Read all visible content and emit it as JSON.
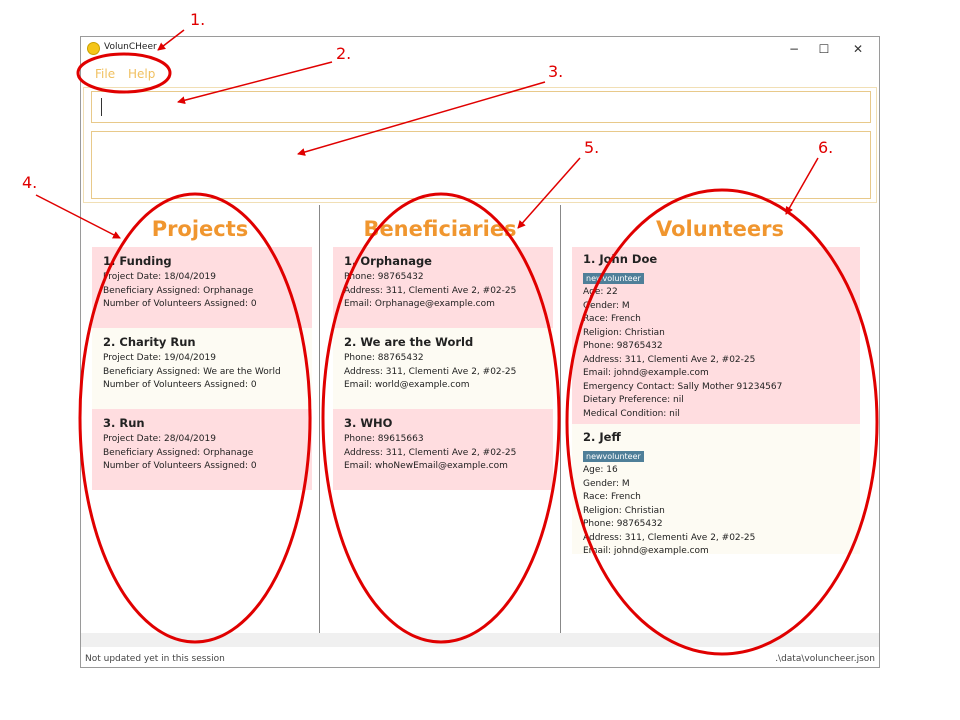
{
  "window": {
    "title": "VolunCHeer",
    "controls": {
      "minimize": "−",
      "maximize": "☐",
      "close": "✕"
    }
  },
  "menu": {
    "items": [
      "File",
      "Help"
    ]
  },
  "command_box": {
    "value": ""
  },
  "result_box": {
    "value": ""
  },
  "columns": {
    "projects": {
      "title": "Projects",
      "cards": [
        {
          "title": "1.  Funding",
          "lines": [
            "Project Date: 18/04/2019",
            "Beneficiary Assigned: Orphanage",
            "Number of Volunteers Assigned: 0"
          ]
        },
        {
          "title": "2.  Charity Run",
          "lines": [
            "Project Date: 19/04/2019",
            "Beneficiary Assigned: We are the World",
            "Number of Volunteers Assigned: 0"
          ]
        },
        {
          "title": "3.  Run",
          "lines": [
            "Project Date: 28/04/2019",
            "Beneficiary Assigned: Orphanage",
            "Number of Volunteers Assigned: 0"
          ]
        }
      ]
    },
    "beneficiaries": {
      "title": "Beneficiaries",
      "cards": [
        {
          "title": "1.  Orphanage",
          "lines": [
            "Phone: 98765432",
            "Address: 311, Clementi Ave 2, #02-25",
            "Email: Orphanage@example.com"
          ]
        },
        {
          "title": "2.  We are the World",
          "lines": [
            "Phone: 88765432",
            "Address: 311, Clementi Ave 2, #02-25",
            "Email: world@example.com"
          ]
        },
        {
          "title": "3.  WHO",
          "lines": [
            "Phone: 89615663",
            "Address: 311, Clementi Ave 2, #02-25",
            "Email: whoNewEmail@example.com"
          ]
        }
      ]
    },
    "volunteers": {
      "title": "Volunteers",
      "cards": [
        {
          "title": "1.  John Doe",
          "tag": "newvolunteer",
          "lines": [
            "Age: 22",
            "Gender: M",
            "Race: French",
            "Religion: Christian",
            "Phone: 98765432",
            "Address: 311, Clementi Ave 2, #02-25",
            "Email: johnd@example.com",
            "Emergency Contact: Sally Mother 91234567",
            "Dietary Preference: nil",
            "Medical Condition: nil"
          ]
        },
        {
          "title": "2.  Jeff",
          "tag": "newvolunteer",
          "lines": [
            "Age: 16",
            "Gender: M",
            "Race: French",
            "Religion: Christian",
            "Phone: 98765432",
            "Address: 311, Clementi Ave 2, #02-25",
            "Email: johnd@example.com"
          ]
        }
      ]
    }
  },
  "status_bar": {
    "left": "Not updated yet in this session",
    "right": ".\\data\\voluncheer.json"
  },
  "annotations": [
    "1.",
    "2.",
    "3.",
    "4.",
    "5.",
    "6."
  ],
  "colors": {
    "accent": "#f0962f",
    "card_pink": "#ffdde0",
    "card_cream": "#fdfbf3",
    "tag": "#4f7f99",
    "annotation": "#e00000"
  }
}
